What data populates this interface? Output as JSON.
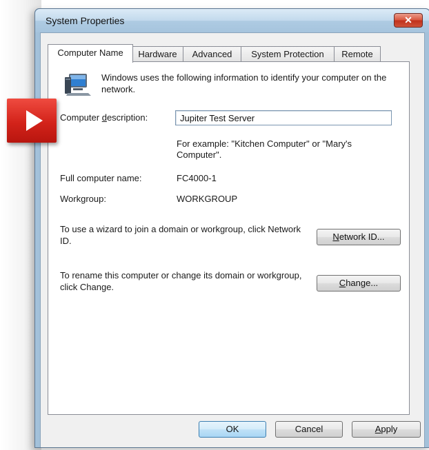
{
  "window": {
    "title": "System Properties",
    "close_glyph": "✕"
  },
  "tabs": [
    {
      "label": "Computer Name",
      "active": true
    },
    {
      "label": "Hardware",
      "active": false
    },
    {
      "label": "Advanced",
      "active": false
    },
    {
      "label": "System Protection",
      "active": false
    },
    {
      "label": "Remote",
      "active": false
    }
  ],
  "panel": {
    "intro": "Windows uses the following information to identify your computer on the network.",
    "description_label_pre": "Computer ",
    "description_label_key": "d",
    "description_label_post": "escription:",
    "description_value": "Jupiter Test Server",
    "hint": "For example: \"Kitchen Computer\" or \"Mary's Computer\".",
    "full_name_label": "Full computer name:",
    "full_name_value": "FC4000-1",
    "workgroup_label": "Workgroup:",
    "workgroup_value": "WORKGROUP",
    "network_id_text": "To use a wizard to join a domain or workgroup, click Network ID.",
    "network_id_button_key": "N",
    "network_id_button_rest": "etwork ID...",
    "rename_text": "To rename this computer or change its domain or workgroup, click Change.",
    "change_button_key": "C",
    "change_button_rest": "hange..."
  },
  "footer": {
    "ok_label": "OK",
    "cancel_label": "Cancel",
    "apply_key": "A",
    "apply_rest": "pply"
  },
  "icons": {
    "computer": "computer-icon",
    "marker": "play-arrow-icon"
  },
  "colors": {
    "titlebar": "#a6c4dd",
    "close_button": "#c0301b",
    "marker": "#d3231a",
    "default_button": "#bfe1f7"
  }
}
